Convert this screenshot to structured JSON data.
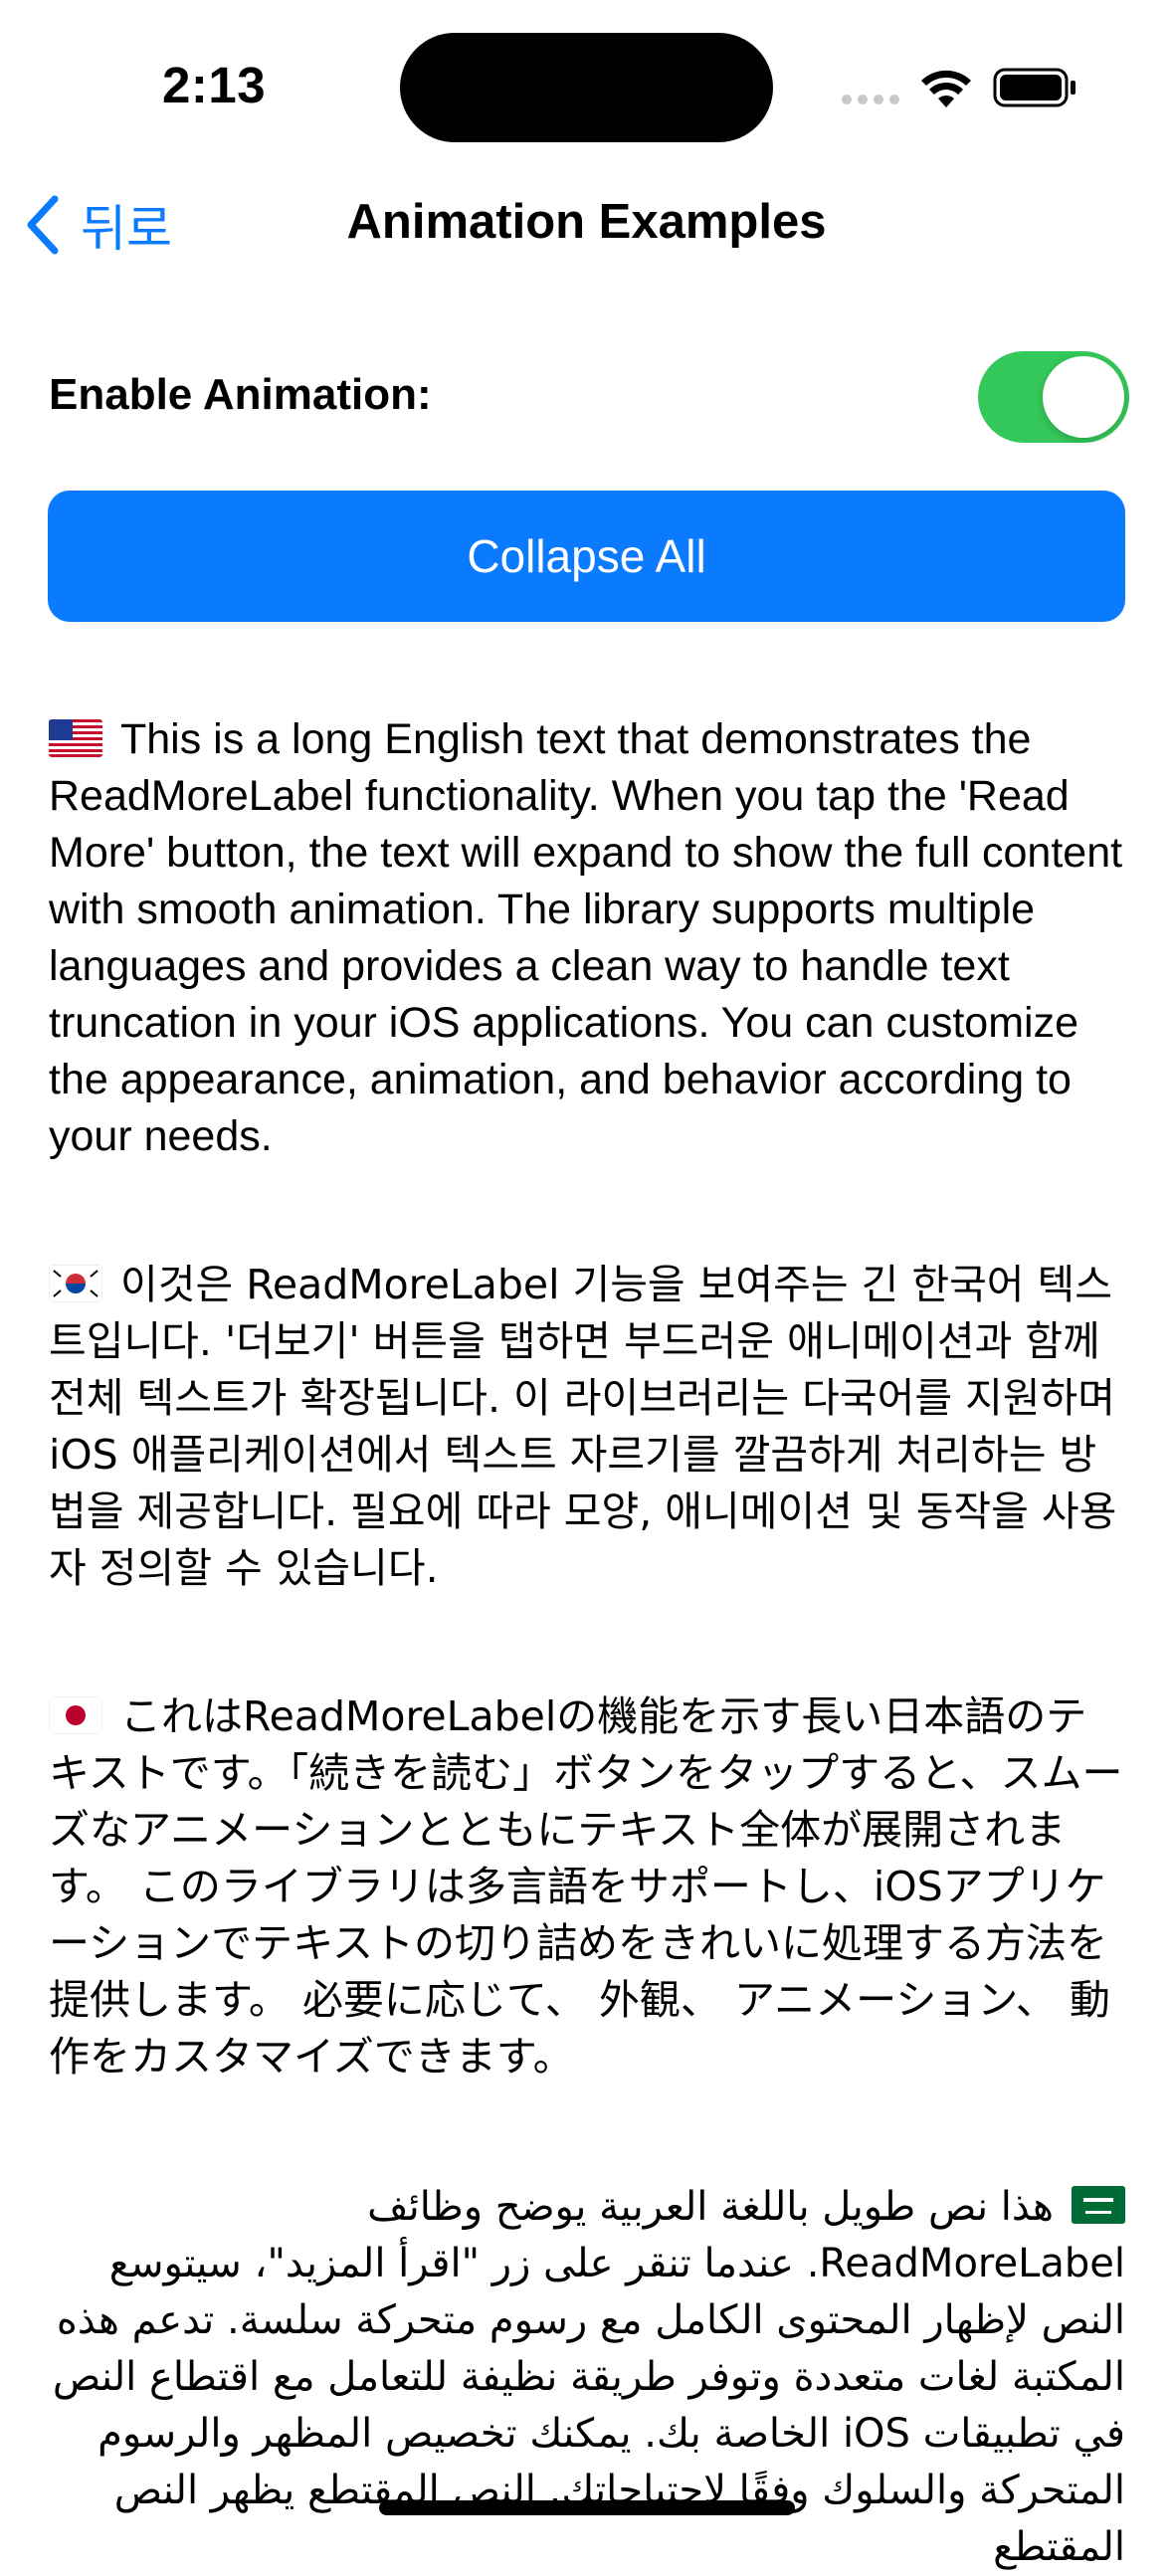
{
  "status_bar": {
    "time": "2:13"
  },
  "nav": {
    "back_label": "뒤로",
    "title": "Animation Examples"
  },
  "settings": {
    "toggle_label": "Enable Animation:",
    "toggle_on": true
  },
  "actions": {
    "collapse_label": "Collapse All"
  },
  "texts": {
    "en": "This is a long English text that demonstrates the ReadMoreLabel functionality. When you tap the 'Read More' button, the text will expand to show the full content with smooth animation. The library supports multiple languages and provides a clean way to handle text truncation in your iOS applications. You can customize the appearance, animation, and behavior according to your needs.",
    "ko": "이것은 ReadMoreLabel 기능을 보여주는 긴 한국어 텍스트입니다. '더보기' 버튼을 탭하면 부드러운 애니메이션과 함께 전체 텍스트가 확장됩니다. 이 라이브러리는 다국어를 지원하며 iOS 애플리케이션에서 텍스트 자르기를 깔끔하게 처리하는 방법을 제공합니다. 필요에 따라 모양, 애니메이션 및 동작을 사용자 정의할 수 있습니다.",
    "ja": "これはReadMoreLabelの機能を示す長い日本語のテキストです。「続きを読む」ボタンをタップすると、スムーズなアニメーションとともにテキスト全体が展開されます。 このライブラリは多言語をサポートし、iOSアプリケーションでテキストの切り詰めをきれいに処理する方法を提供します。 必要に応じて、 外観、 アニメーション、 動作をカスタマイズできます。",
    "ar": "هذا نص طويل باللغة العربية يوضح وظائف ReadMoreLabel. عندما تنقر على زر \"اقرأ المزيد\"، سيتوسع النص لإظهار المحتوى الكامل مع رسوم متحركة سلسة. تدعم هذه المكتبة لغات متعددة وتوفر طريقة نظيفة للتعامل مع اقتطاع النص في تطبيقات iOS الخاصة بك. يمكنك تخصيص المظهر والرسوم المتحركة والسلوك وفقًا لاحتياجاتك. النص المقتطع يظهر النص المقتطع"
  },
  "colors": {
    "accent": "#0a7aff",
    "toggle_on": "#34c759"
  }
}
